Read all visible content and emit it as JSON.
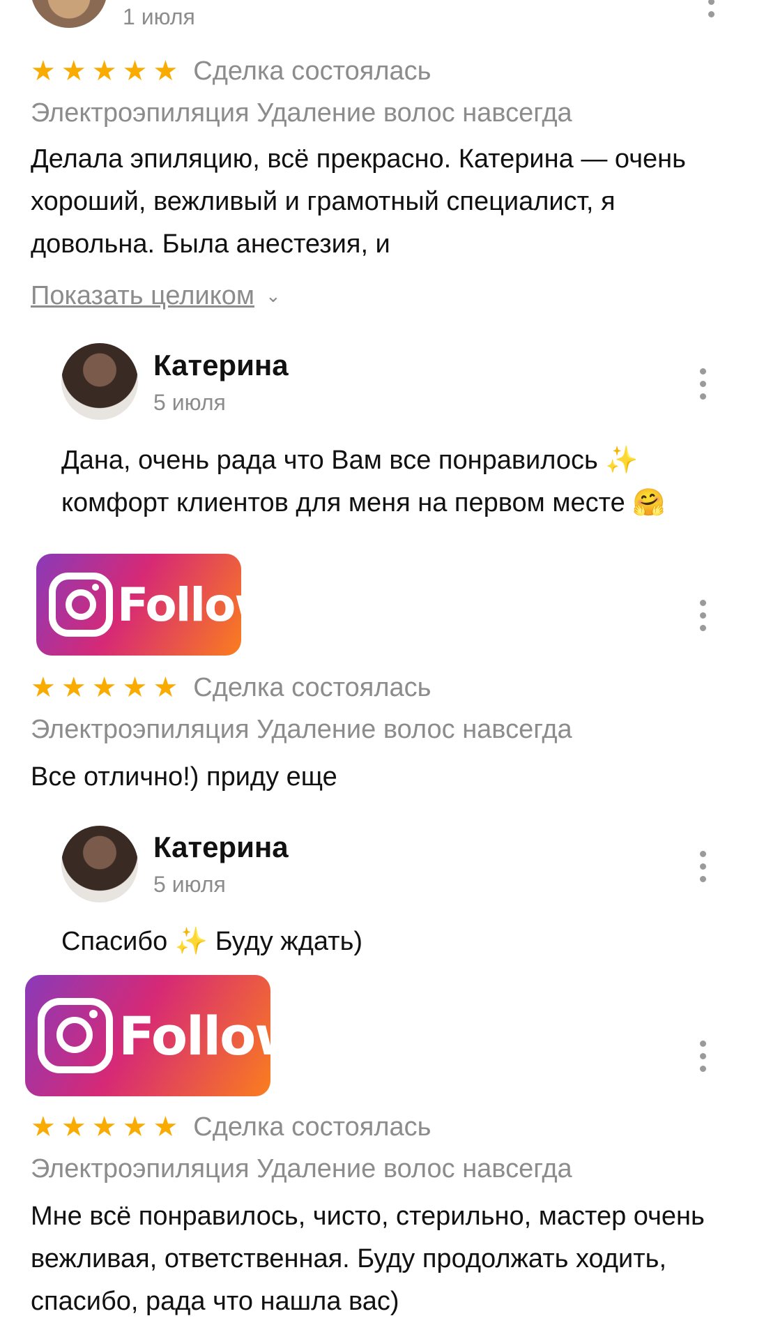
{
  "review1": {
    "date": "1 июля",
    "rating": 5,
    "deal_status": "Сделка состоялась",
    "service": "Электроэпиляция Удаление волос навсегда",
    "text": "Делала эпиляцию, всё прекрасно. Катерина — очень хороший, вежливый и грамотный специалист,  я довольна. Была анестезия, и",
    "show_more": "Показать целиком",
    "reply": {
      "name": "Катерина",
      "date": "5 июля",
      "text": "Дана, очень рада что Вам все понравилось ✨ комфорт клиентов для меня на первом месте 🤗"
    }
  },
  "review2": {
    "badge": "Follow",
    "rating": 5,
    "deal_status": "Сделка состоялась",
    "service": "Электроэпиляция Удаление волос навсегда",
    "text": "Все отлично!) приду еще",
    "reply": {
      "name": "Катерина",
      "date": "5 июля",
      "text": "Спасибо ✨ Буду ждать)"
    }
  },
  "review3": {
    "badge": "Follow",
    "rating": 5,
    "deal_status": "Сделка состоялась",
    "service": "Электроэпиляция Удаление волос навсегда",
    "text": "Мне всё понравилось, чисто, стерильно, мастер очень вежливая, ответственная. Буду продолжать ходить, спасибо, рада что нашла вас)"
  },
  "icons": {
    "star": "star-icon",
    "more": "more-vert-icon",
    "chevron": "chevron-down-icon",
    "instagram": "instagram-icon"
  },
  "colors": {
    "star": "#f9ab00",
    "muted": "#8c8c8c",
    "follow_gradient_start": "#8a3ab9",
    "follow_gradient_mid": "#d62976",
    "follow_gradient_end": "#fa7e1e"
  }
}
